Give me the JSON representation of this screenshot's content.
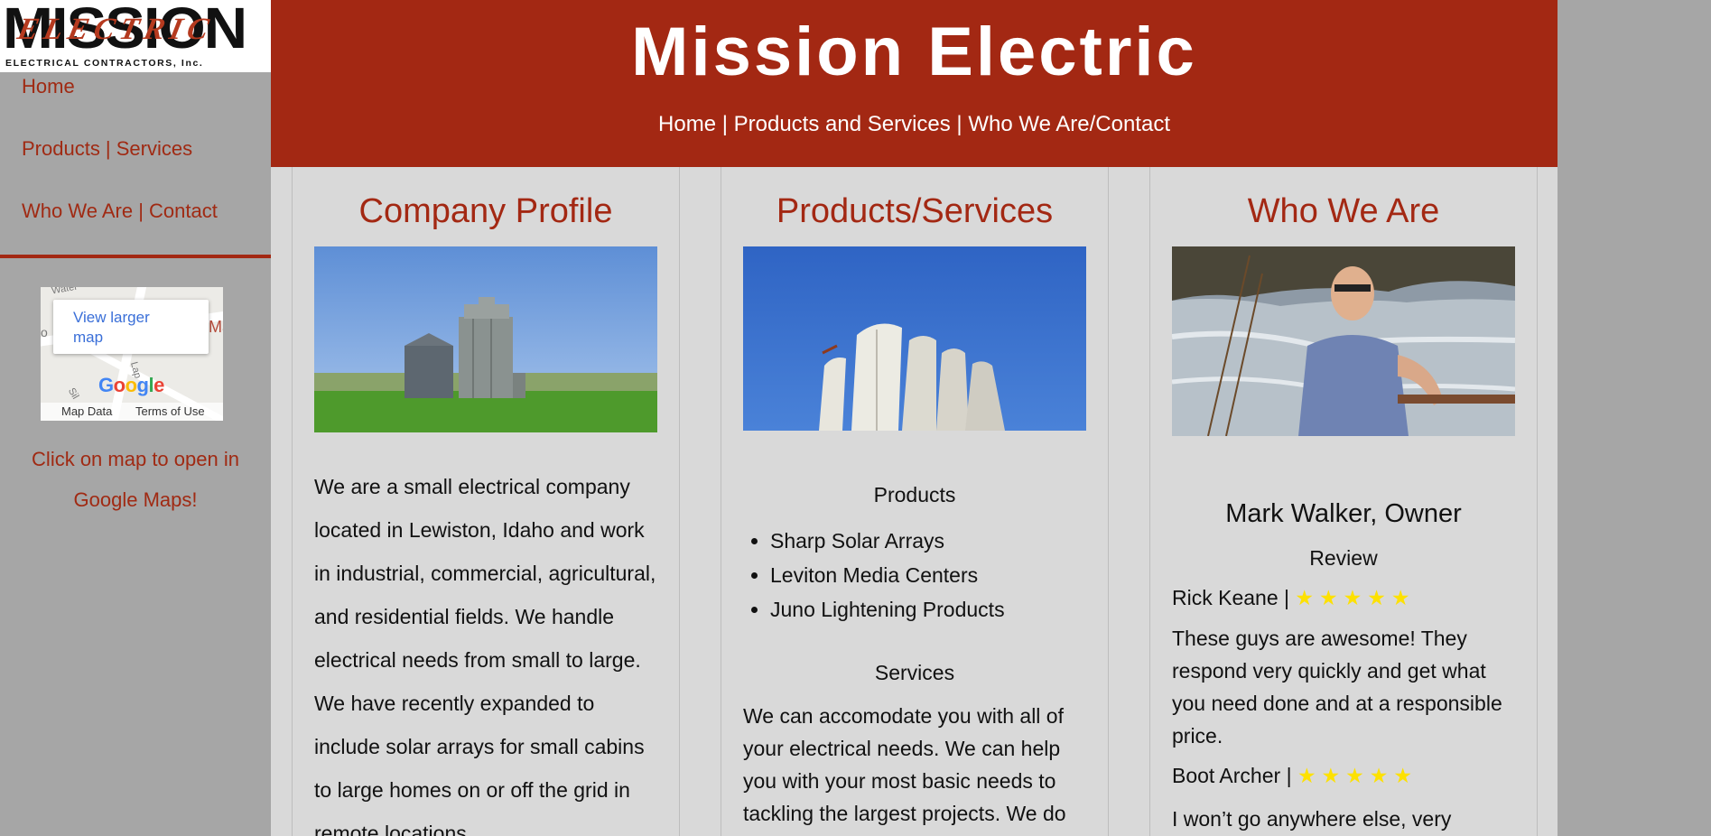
{
  "sidebar": {
    "logo": {
      "big_text": "MISSION",
      "script_text": "ELECTRIC",
      "small_text": "ELECTRICAL CONTRACTORS, Inc."
    },
    "nav": [
      {
        "label": "Home"
      },
      {
        "label": "Products | Services"
      },
      {
        "label": "Who We Are | Contact"
      }
    ],
    "map": {
      "card_link": "View larger map",
      "logo": "Google",
      "footer_left": "Map Data",
      "footer_right": "Terms of Use",
      "street_labels": [
        "Water",
        "Lap",
        "Ma",
        "Sil",
        "o"
      ]
    },
    "map_hint": "Click on map to open in Google Maps!"
  },
  "header": {
    "title": "Mission Electric",
    "nav": [
      "Home",
      "Products and Services",
      "Who We Are/Contact"
    ],
    "separator": " | "
  },
  "columns": {
    "profile": {
      "heading": "Company Profile",
      "text": "We are a small electrical company located in Lewiston, Idaho and work in industrial, commercial, agricultural, and residential fields. We handle electrical needs from small to large. We have recently expanded to include solar arrays for small cabins to large homes on or off the grid in remote locations."
    },
    "products": {
      "heading": "Products/Services",
      "products_title": "Products",
      "products": [
        "Sharp Solar Arrays",
        "Leviton Media Centers",
        "Juno Lightening Products"
      ],
      "services_title": "Services",
      "services_text": "We can accomodate you with all of your electrical needs. We can help you with your most basic needs to tackling the largest projects. We do"
    },
    "who": {
      "heading": "Who We Are",
      "owner": "Mark Walker, Owner",
      "review_title": "Review",
      "reviews": [
        {
          "name": "Rick Keane |",
          "stars": "★★★★★",
          "text": "These guys are awesome! They respond very quickly and get what you need done and at a responsible price."
        },
        {
          "name": "Boot Archer |",
          "stars": "★★★★★",
          "text": "I won’t go anywhere else, very"
        }
      ]
    }
  },
  "colors": {
    "brand_red": "#a32813",
    "link_red": "#a02a13",
    "sidebar_gray": "#a6a6a6",
    "content_gray": "#d9d9d9",
    "star_yellow": "#fde100"
  }
}
